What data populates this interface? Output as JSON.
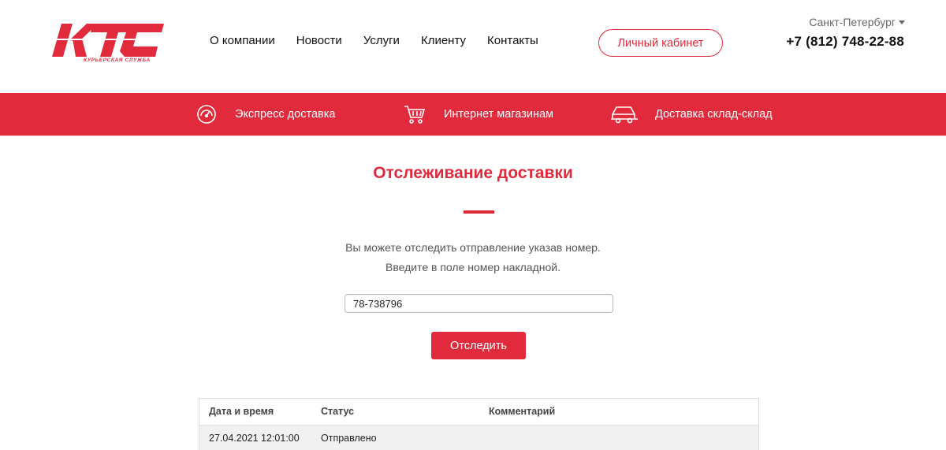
{
  "header": {
    "logo_sub": "КУРЬЕРСКАЯ СЛУЖБА",
    "nav": [
      "О компании",
      "Новости",
      "Услуги",
      "Клиенту",
      "Контакты"
    ],
    "cabinet_label": "Личный кабинет",
    "city": "Санкт-Петербург",
    "phone": "+7 (812) 748-22-88"
  },
  "band": {
    "items": [
      {
        "label": "Экспресс доставка",
        "icon": "speedometer-icon"
      },
      {
        "label": "Интернет магазинам",
        "icon": "shopping-cart-icon"
      },
      {
        "label": "Доставка склад-склад",
        "icon": "truck-icon"
      }
    ]
  },
  "main": {
    "title": "Отслеживание доставки",
    "desc_line1": "Вы можете отследить отправление указав номер.",
    "desc_line2": "Введите в поле номер накладной.",
    "input_value": "78-738796",
    "track_label": "Отследить"
  },
  "table": {
    "headers": [
      "Дата и время",
      "Статус",
      "Комментарий"
    ],
    "rows": [
      [
        "27.04.2021 12:01:00",
        "Отправлено",
        ""
      ]
    ]
  },
  "colors": {
    "brand_red": "#e22a3d"
  }
}
